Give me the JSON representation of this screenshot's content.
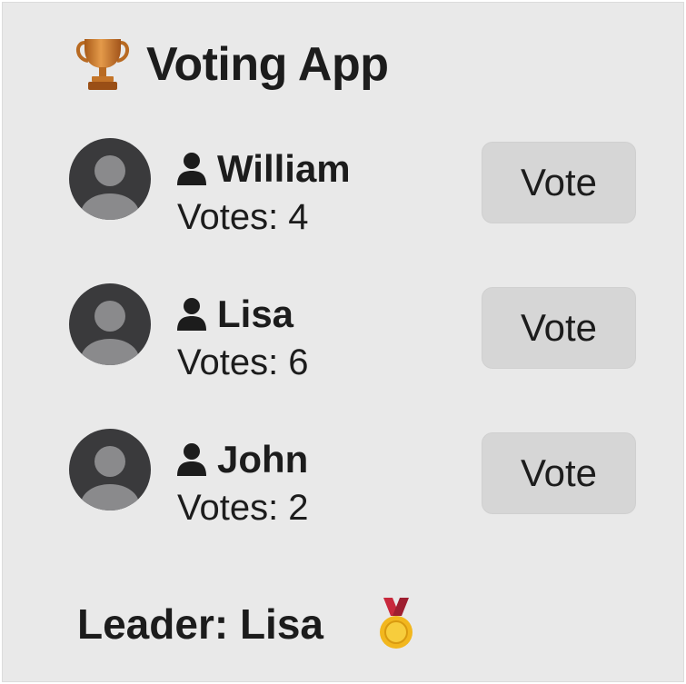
{
  "app": {
    "title": "Voting App",
    "title_icon": "trophy-icon"
  },
  "candidates": [
    {
      "name": "William",
      "votes_text": "Votes: 4",
      "votes": 4,
      "button_label": "Vote"
    },
    {
      "name": "Lisa",
      "votes_text": "Votes: 6",
      "votes": 6,
      "button_label": "Vote"
    },
    {
      "name": "John",
      "votes_text": "Votes: 2",
      "votes": 2,
      "button_label": "Vote"
    }
  ],
  "leader": {
    "text": "Leader: Lisa",
    "icon": "medal-icon"
  },
  "colors": {
    "background": "#e9e9e9",
    "button": "#d6d6d6",
    "text": "#1c1c1c",
    "avatar_bg": "#3a3a3c",
    "avatar_figure": "#8a8a8c",
    "trophy": "#c97a26",
    "medal_gold": "#f2b71e",
    "medal_ribbon": "#c8283c"
  }
}
